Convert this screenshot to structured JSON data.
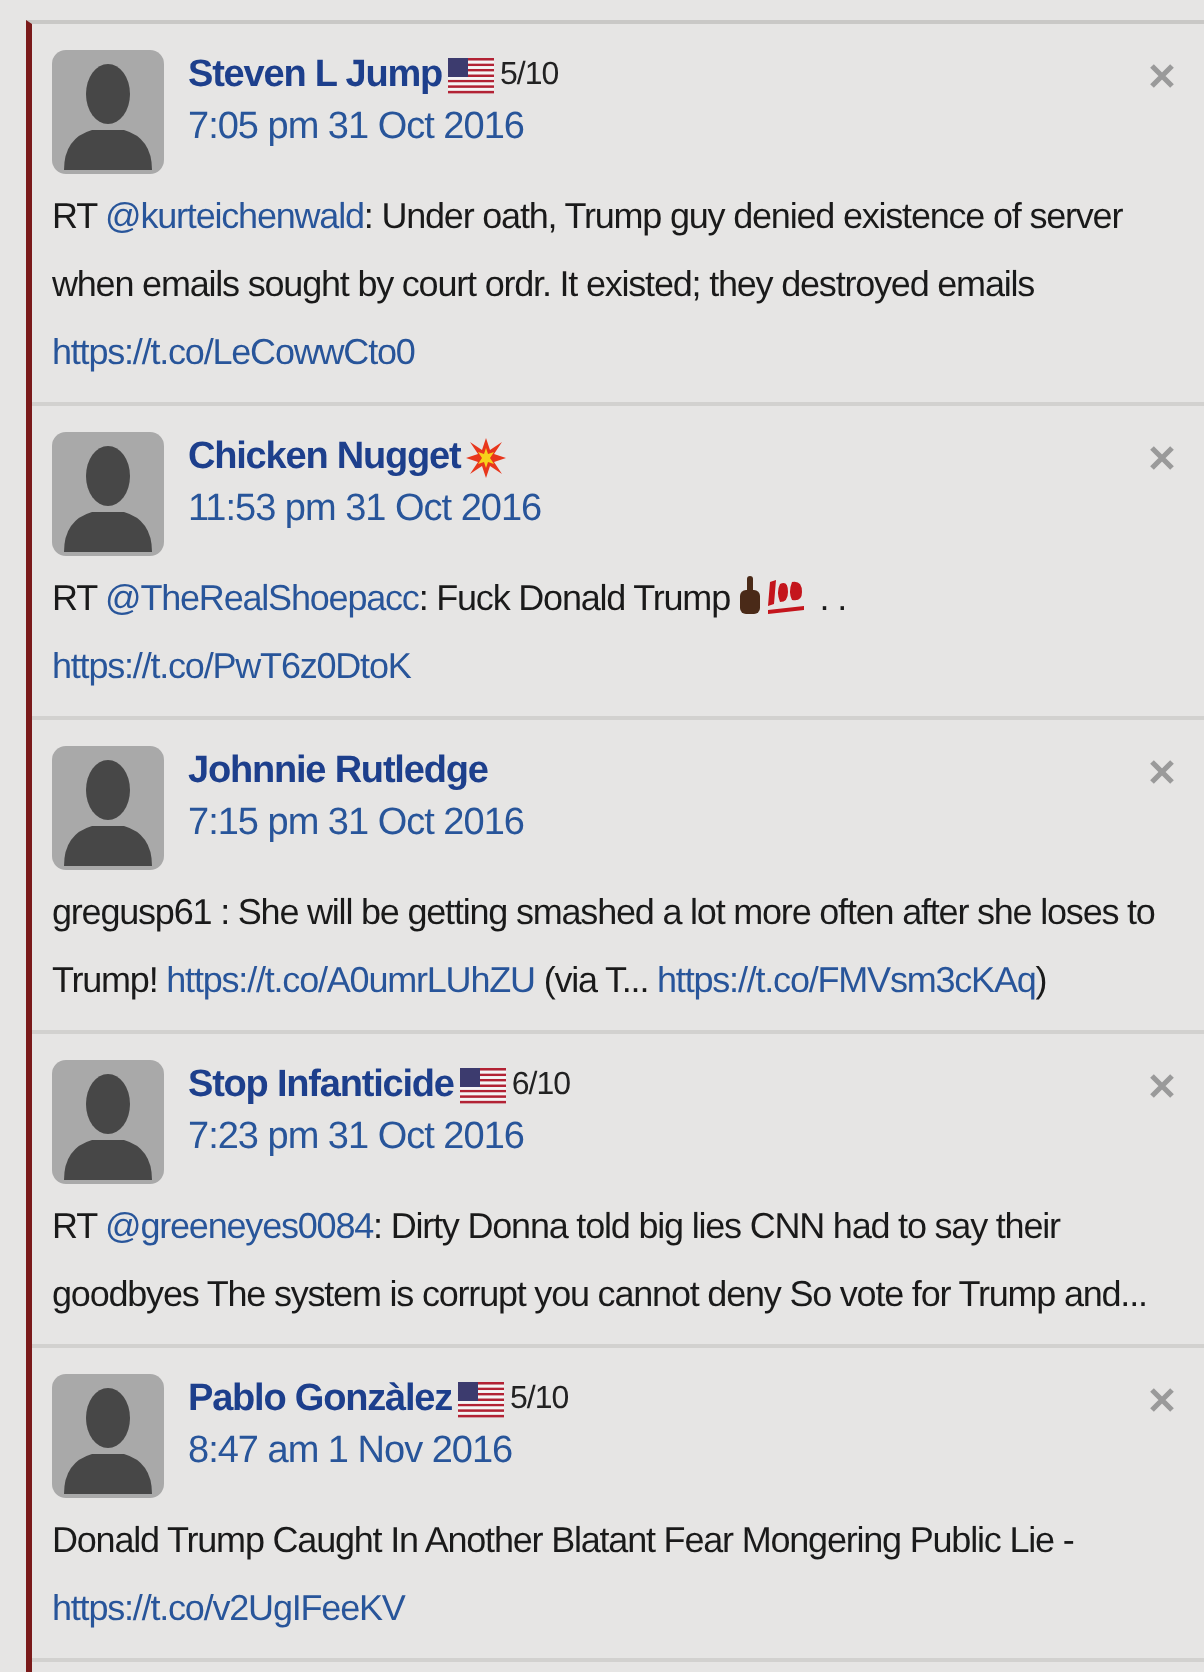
{
  "tweets": [
    {
      "name": "Steven L Jump",
      "flag": true,
      "score": "5/10",
      "time": "7:05 pm 31 Oct 2016",
      "body": [
        {
          "kind": "text",
          "text": "RT "
        },
        {
          "kind": "mention",
          "text": "@kurteichenwald"
        },
        {
          "kind": "text",
          "text": ": Under oath, Trump guy denied existence of server when emails sought by court ordr. It existed; they destroyed emails "
        },
        {
          "kind": "link",
          "text": "https://t.co/LeCowwCto0"
        }
      ]
    },
    {
      "name": "Chicken Nugget",
      "explosion": true,
      "time": "11:53 pm 31 Oct 2016",
      "body": [
        {
          "kind": "text",
          "text": "RT "
        },
        {
          "kind": "mention",
          "text": "@TheRealShoepacc"
        },
        {
          "kind": "text",
          "text": ": Fuck Donald Trump "
        },
        {
          "kind": "finger"
        },
        {
          "kind": "hundred"
        },
        {
          "kind": "text",
          "text": " . . "
        },
        {
          "kind": "break"
        },
        {
          "kind": "link",
          "text": "https://t.co/PwT6z0DtoK"
        }
      ]
    },
    {
      "name": "Johnnie Rutledge",
      "time": "7:15 pm 31 Oct 2016",
      "body": [
        {
          "kind": "text",
          "text": "gregusp61 : She will be getting smashed a lot more often after she loses to Trump! "
        },
        {
          "kind": "link",
          "text": "https://t.co/A0umrLUhZU"
        },
        {
          "kind": "text",
          "text": " (via T... "
        },
        {
          "kind": "link",
          "text": "https://t.co/FMVsm3cKAq"
        },
        {
          "kind": "text",
          "text": ")"
        }
      ]
    },
    {
      "name": "Stop Infanticide",
      "flag": true,
      "score": "6/10",
      "time": "7:23 pm 31 Oct 2016",
      "body": [
        {
          "kind": "text",
          "text": "RT "
        },
        {
          "kind": "mention",
          "text": "@greeneyes0084"
        },
        {
          "kind": "text",
          "text": ": Dirty Donna told big lies CNN had to say their goodbyes The system is corrupt you cannot deny So vote for Trump and..."
        }
      ]
    },
    {
      "name": "Pablo Gonzàlez",
      "flag": true,
      "score": "5/10",
      "time": "8:47 am 1 Nov 2016",
      "body": [
        {
          "kind": "text",
          "text": "Donald Trump Caught In Another Blatant Fear Mongering Public Lie - "
        },
        {
          "kind": "link",
          "text": "https://t.co/v2UgIFeeKV"
        }
      ]
    }
  ]
}
